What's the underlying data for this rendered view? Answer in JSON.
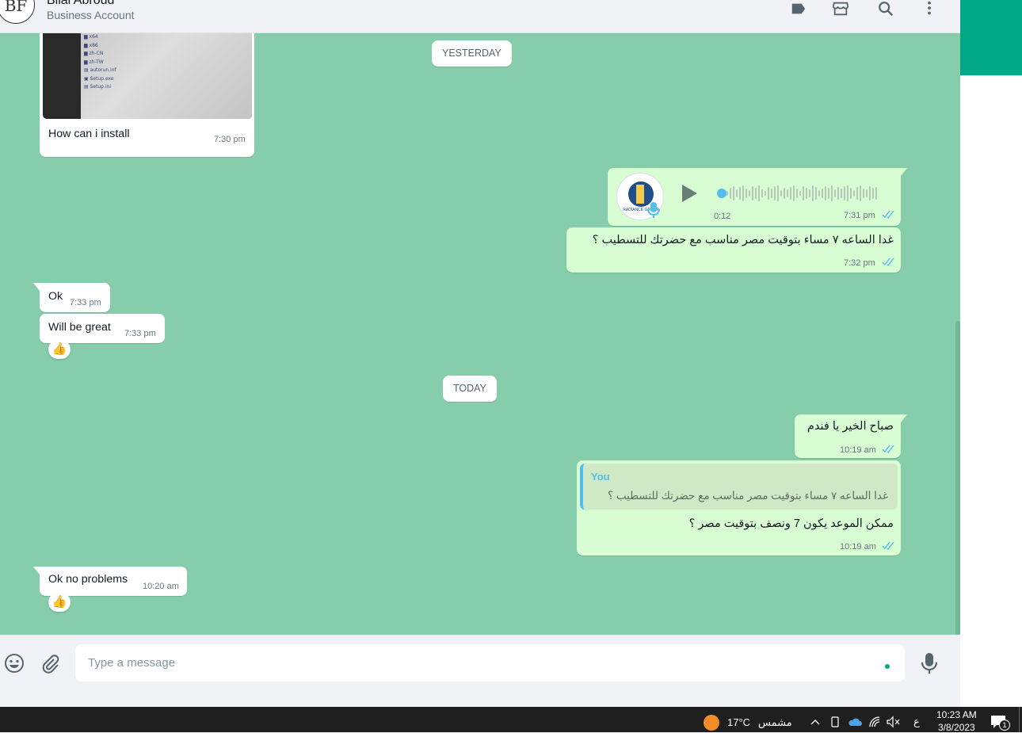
{
  "header": {
    "avatar_initials": "BF",
    "contact_name": "Bilal Abroud",
    "contact_subtitle": "Business Account",
    "icons": [
      "label-icon",
      "store-icon",
      "search-icon",
      "menu-icon"
    ]
  },
  "chat": {
    "dates": {
      "yesterday": "YESTERDAY",
      "today": "TODAY"
    },
    "image_message": {
      "caption": "How can i install",
      "time": "7:30 pm",
      "screen_lines": [
        "x64",
        "x86",
        "zh-CN",
        "zh-TW",
        "autorun.inf",
        "Setup.exe",
        "Setup.ini"
      ]
    },
    "voice_message": {
      "duration": "0:12",
      "time": "7:31 pm",
      "avatar_text": "RADIANCE GROUP"
    },
    "out_1": {
      "text": "غدا الساعه ٧ مساء بتوقيت مصر مناسب مع حضرتك للتسطيب ؟",
      "time": "7:32 pm"
    },
    "in_ok": {
      "text": "Ok",
      "time": "7:33 pm"
    },
    "in_great": {
      "text": "Will be great",
      "time": "7:33 pm",
      "reaction": "👍"
    },
    "out_2": {
      "text": "صباح الخير يا فندم",
      "time": "10:19 am"
    },
    "out_3": {
      "quote_author": "You",
      "quote_text": "غدا الساعه ٧ مساء بتوقيت مصر مناسب مع حضرتك للتسطيب ؟",
      "text": "ممكن الموعد يكون 7 ونصف بتوقيت مصر ؟",
      "time": "10:19 am"
    },
    "in_noprob": {
      "text": "Ok no problems",
      "time": "10:20 am",
      "reaction": "👍"
    }
  },
  "composer": {
    "placeholder": "Type a message"
  },
  "taskbar": {
    "temperature": "17°C",
    "weather": "مشمس",
    "language": "ع",
    "time": "10:23 AM",
    "date": "3/8/2023",
    "notification_count": "1"
  }
}
